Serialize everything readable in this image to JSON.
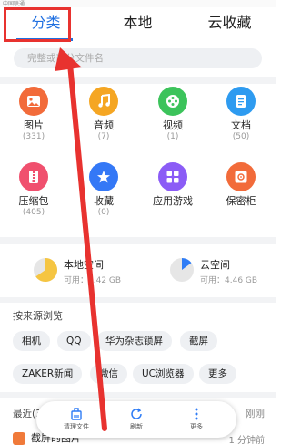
{
  "status_bar": {
    "carrier": "中国联通"
  },
  "tabs": [
    {
      "label": "分类",
      "active": true
    },
    {
      "label": "本地",
      "active": false
    },
    {
      "label": "云收藏",
      "active": false
    }
  ],
  "search": {
    "placeholder": "完整或部分文件名"
  },
  "categories": [
    {
      "label": "图片",
      "count": "(331)",
      "icon": "image-icon",
      "color": "#f26b3a"
    },
    {
      "label": "音频",
      "count": "(7)",
      "icon": "music-icon",
      "color": "#f5a623"
    },
    {
      "label": "视频",
      "count": "(1)",
      "icon": "video-icon",
      "color": "#3cc35b"
    },
    {
      "label": "文档",
      "count": "(50)",
      "icon": "document-icon",
      "color": "#2e9bf0"
    },
    {
      "label": "压缩包",
      "count": "(405)",
      "icon": "zip-icon",
      "color": "#f0506e"
    },
    {
      "label": "收藏",
      "count": "(0)",
      "icon": "star-icon",
      "color": "#3478f6"
    },
    {
      "label": "应用游戏",
      "count": "",
      "icon": "apps-icon",
      "color": "#8b5cf6"
    },
    {
      "label": "保密柜",
      "count": "",
      "icon": "safe-icon",
      "color": "#f26b3a"
    }
  ],
  "storage": {
    "local": {
      "title": "本地空间",
      "sub": "可用：3.42 GB",
      "color": "#f5c542"
    },
    "cloud": {
      "title": "云空间",
      "sub": "可用：4.46 GB",
      "color": "#2e7cf6"
    }
  },
  "browse_by_source": {
    "title": "按来源浏览",
    "chips": [
      "相机",
      "QQ",
      "华为杂志锁屏",
      "截屏",
      "ZAKER新闻",
      "微信",
      "UC浏览器",
      "更多"
    ]
  },
  "recent": {
    "title": "最近(3",
    "right": "刚刚",
    "item": "截屏的图片",
    "time": "1 分钟前"
  },
  "bottom_bar": {
    "items": [
      {
        "label": "清理文件",
        "icon": "broom-icon"
      },
      {
        "label": "刷新",
        "icon": "refresh-icon"
      },
      {
        "label": "更多",
        "icon": "more-icon"
      }
    ]
  },
  "annotation": {
    "highlight_color": "#e8322f"
  }
}
